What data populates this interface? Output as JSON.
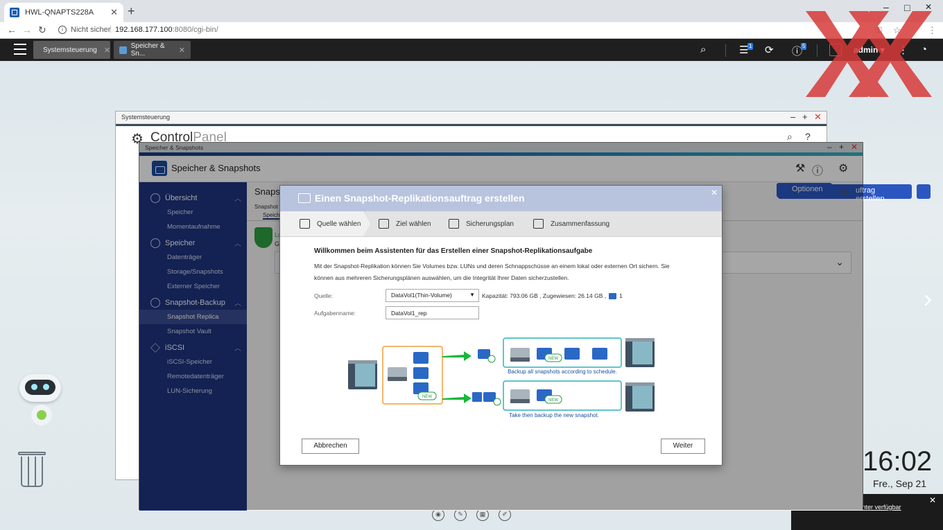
{
  "browser": {
    "tab_title": "HWL-QNAPTS228A",
    "new_tab": "+",
    "win_min": "–",
    "win_max": "□",
    "win_close": "✕",
    "not_secure": "Nicht sicher",
    "url_host": "192.168.177.100",
    "url_rest": ":8080/cgi-bin/"
  },
  "qts": {
    "tabs": [
      {
        "label": "Systemsteuerung",
        "close": "✕"
      },
      {
        "label": "Speicher & Sn...",
        "close": "✕"
      }
    ],
    "task_badge": "1",
    "info_badge": "5",
    "user": "admin ▾"
  },
  "system_window": {
    "title": "Systemsteuerung",
    "cp_control": "Control",
    "cp_panel": "Panel"
  },
  "ss_window": {
    "title": "Speicher & Snapshots",
    "header": "Speicher & Snapshots",
    "content_title": "Snapsh",
    "content_sub": "Snapshot",
    "content_sub2": "Speich",
    "status_l": "Lo",
    "status_g": "Ge",
    "btn_create": "uftrag erstellen",
    "btn_options": "Optionen",
    "sidebar": [
      {
        "section": "Übersicht",
        "items": [
          "Speicher",
          "Momentaufnahme"
        ]
      },
      {
        "section": "Speicher",
        "items": [
          "Datenträger",
          "Storage/Snapshots",
          "Externer Speicher"
        ]
      },
      {
        "section": "Snapshot-Backup",
        "items": [
          "Snapshot Replica",
          "Snapshot Vault"
        ]
      },
      {
        "section": "iSCSI",
        "items": [
          "iSCSI-Speicher",
          "Remotedatenträger",
          "LUN-Sicherung"
        ]
      }
    ]
  },
  "dialog": {
    "title": "Einen Snapshot-Replikationsauftrag erstellen",
    "steps": [
      "Quelle wählen",
      "Ziel wählen",
      "Sicherungsplan",
      "Zusammenfassung"
    ],
    "welcome": "Willkommen beim Assistenten für das Erstellen einer Snapshot-Replikationsaufgabe",
    "description": "Mit der Snapshot-Replikation können Sie Volumes bzw. LUNs und deren Schnappschüsse an einem lokal oder externen Ort sichern. Sie können aus mehreren Sicherungsplänen auswählen, um die Integrität Ihrer Daten sicherzustellen.",
    "source_label": "Quelle:",
    "source_value": "DataVol1(Thin-Volume)",
    "capacity": "Kapazität: 793.06 GB , Zugewiesen: 26.14 GB ,",
    "snap_count": "1",
    "task_label": "Aufgabenname:",
    "task_value": "DataVol1_rep",
    "diagram_text_1": "Backup all snapshots according to schedule.",
    "diagram_text_2": "Take then backup the new snapshot.",
    "new_label": "NEW",
    "cancel": "Abbrechen",
    "next": "Weiter"
  },
  "desktop": {
    "clock": "16:02",
    "date": "Fre., Sep 21",
    "app_center_msg": "... jetzt im App Center verfügbar",
    "app_center_close": "✕"
  },
  "colors": {
    "sidebar": "#1e3480",
    "dialog_header": "#b8c4de",
    "accent": "#2b56c2"
  }
}
